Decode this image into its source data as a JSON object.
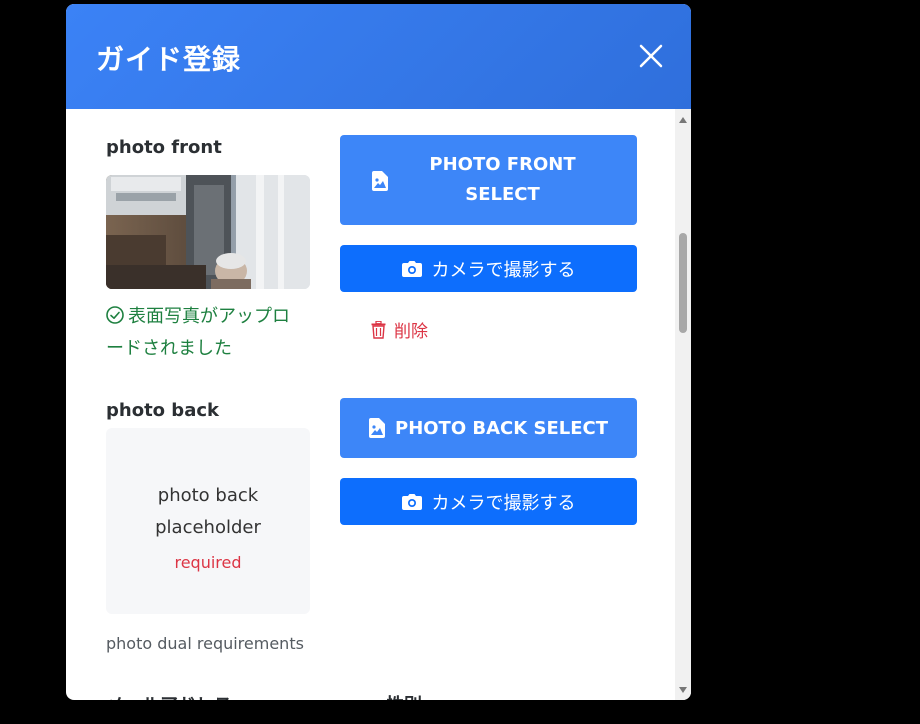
{
  "modal": {
    "title": "ガイド登録"
  },
  "photo_front": {
    "label": "photo front",
    "success_message": "表面写真がアップロードされました",
    "select_button": "PHOTO FRONT SELECT",
    "camera_button": "カメラで撮影する",
    "delete_label": "削除"
  },
  "photo_back": {
    "label": "photo back",
    "placeholder": "photo back placeholder",
    "required": "required",
    "select_button": "PHOTO BACK SELECT",
    "camera_button": "カメラで撮影する"
  },
  "requirements_text": "photo dual requirements",
  "next_fields": {
    "email_label": "メールアドレス",
    "gender_label": "性別"
  },
  "colors": {
    "header": "#3b82f6",
    "light_button": "#3d86f8",
    "primary_button": "#0d6efd",
    "success": "#1e8040",
    "danger": "#dc3545"
  }
}
